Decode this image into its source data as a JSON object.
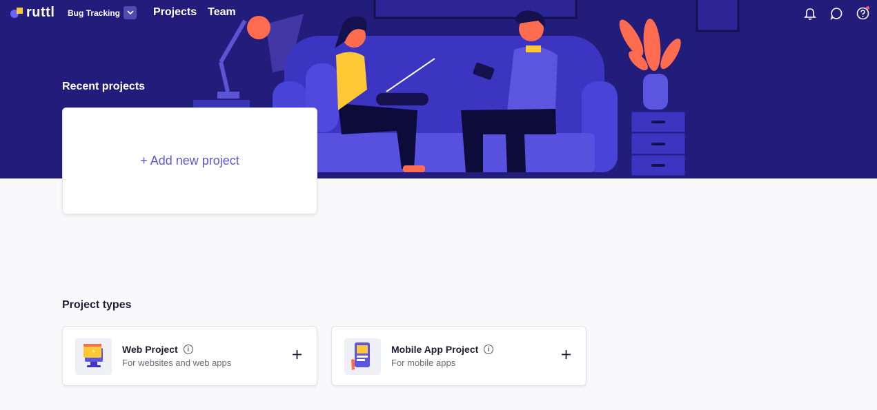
{
  "header": {
    "logo_text": "ruttl",
    "product_label": "Bug Tracking",
    "nav": {
      "projects": "Projects",
      "team": "Team"
    },
    "icons": [
      "bell-icon",
      "chat-icon",
      "help-icon"
    ]
  },
  "recent": {
    "title": "Recent projects",
    "add_label": "+ Add new project"
  },
  "types": {
    "title": "Project types",
    "items": [
      {
        "name": "Web Project",
        "description": "For websites and web apps"
      },
      {
        "name": "Mobile App Project",
        "description": "For mobile apps"
      }
    ]
  },
  "colors": {
    "hero_bg": "#221c7a",
    "accent": "#5b57d0",
    "page_bg": "#f9f9fb"
  }
}
